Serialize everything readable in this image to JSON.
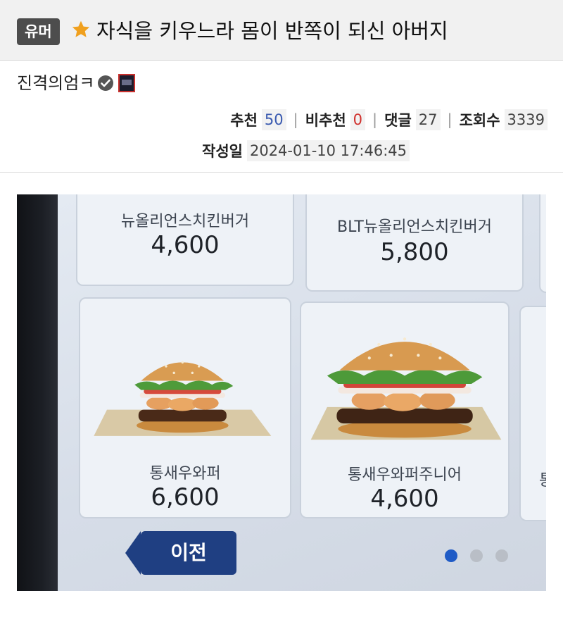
{
  "post": {
    "category": "유머",
    "title": "자식을 키우느라 몸이 반쪽이 되신 아버지",
    "author": "진격의엄ㅋ"
  },
  "stats": {
    "recommend_label": "추천",
    "recommend_value": "50",
    "not_recommend_label": "비추천",
    "not_recommend_value": "0",
    "comments_label": "댓글",
    "comments_value": "27",
    "views_label": "조회수",
    "views_value": "3339",
    "date_label": "작성일",
    "date_value": "2024-01-10 17:46:45"
  },
  "kiosk": {
    "items": [
      {
        "name": "뉴올리언스치킨버거",
        "price": "4,600"
      },
      {
        "name": "BLT뉴올리언스치킨버거",
        "price": "5,800"
      },
      {
        "name": "통새우와퍼",
        "price": "6,600"
      },
      {
        "name": "통새우와퍼주니어",
        "price": "4,600"
      }
    ],
    "partial_item_name": "통",
    "prev_button": "이전",
    "page_dots": {
      "total": 3,
      "active": 1
    }
  },
  "colors": {
    "accent_star": "#f0a01e",
    "badge_bg": "#4d4d4d",
    "recommend": "#3a5ab0",
    "not_recommend": "#d0312d",
    "kiosk_button": "#1f3f82",
    "dot_active": "#1f5bc6",
    "dot_inactive": "#b9bec6"
  },
  "icons": [
    "star-icon",
    "verified-check-icon",
    "author-thumbnail-icon",
    "burger-image"
  ]
}
